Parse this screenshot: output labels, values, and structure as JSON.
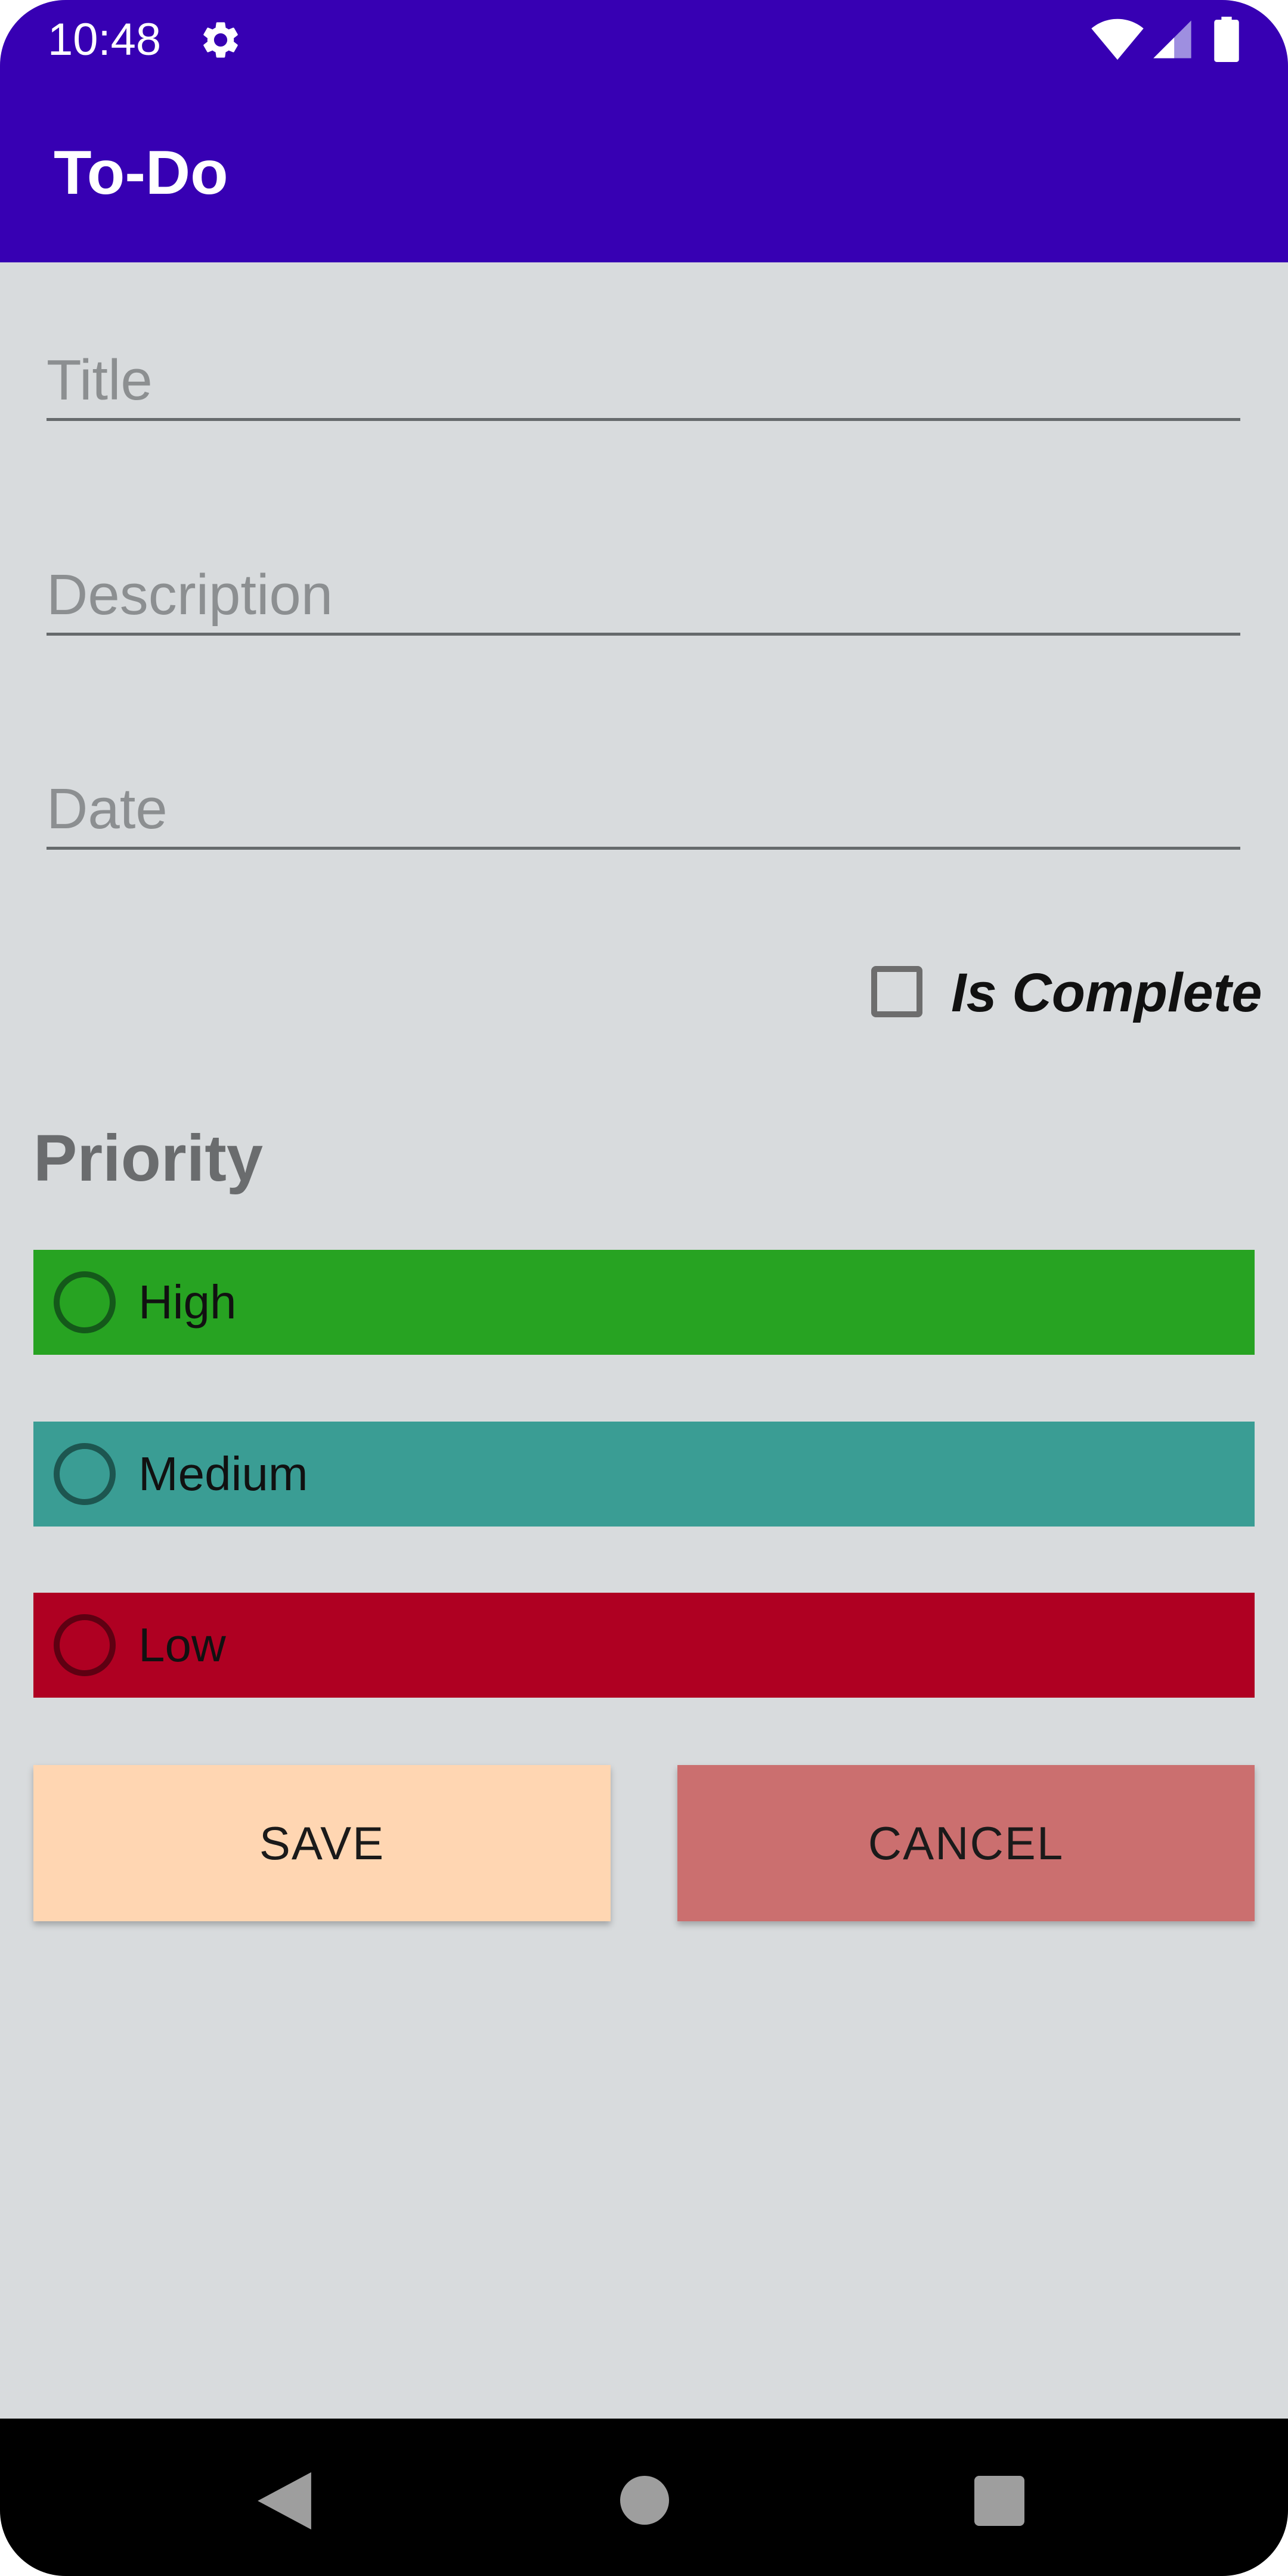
{
  "status_bar": {
    "time": "10:48",
    "icons": [
      "gear-icon",
      "wifi-icon",
      "signal-icon",
      "battery-icon"
    ]
  },
  "app_bar": {
    "title": "To-Do",
    "color": "#3700b3"
  },
  "form": {
    "title": {
      "value": "",
      "placeholder": "Title"
    },
    "description": {
      "value": "",
      "placeholder": "Description"
    },
    "date": {
      "value": "",
      "placeholder": "Date"
    }
  },
  "is_complete": {
    "label": "Is Complete",
    "checked": false
  },
  "priority": {
    "heading": "Priority",
    "options": [
      {
        "label": "High",
        "color": "#27a322",
        "selected": false
      },
      {
        "label": "Medium",
        "color": "#3a9d94",
        "selected": false
      },
      {
        "label": "Low",
        "color": "#af0022",
        "selected": false
      }
    ]
  },
  "buttons": {
    "save": {
      "label": "SAVE",
      "color": "#ffd6b2"
    },
    "cancel": {
      "label": "CANCEL",
      "color": "#cb6f6f"
    }
  },
  "nav_bar": {
    "icons": [
      "back-icon",
      "home-icon",
      "recents-icon"
    ]
  }
}
